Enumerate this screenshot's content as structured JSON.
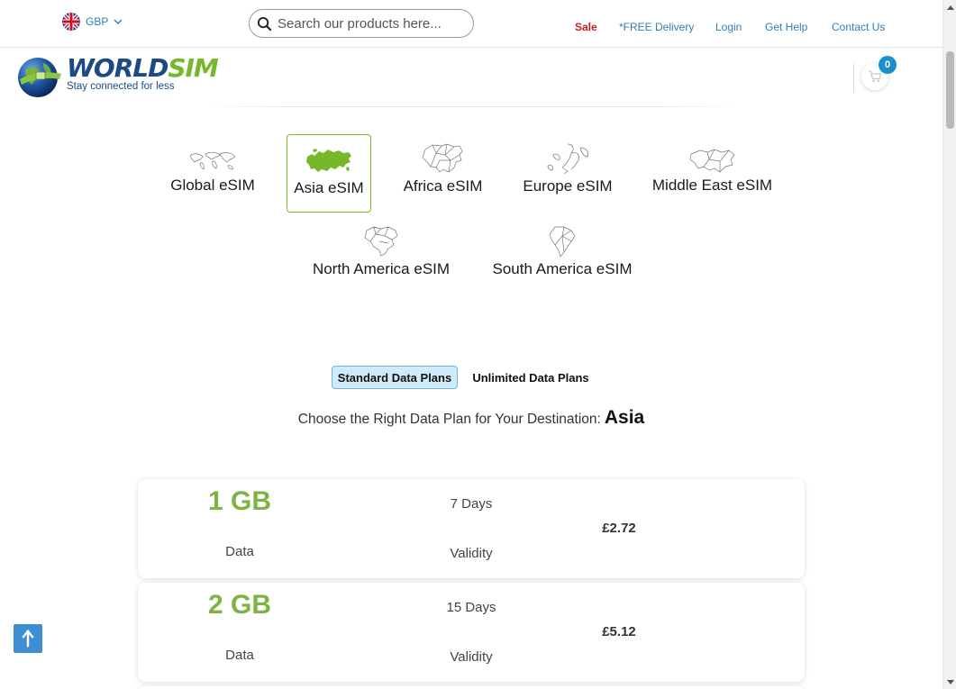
{
  "topbar": {
    "currency": "GBP",
    "search_placeholder": "Search our products here...",
    "links": [
      {
        "label": "Sale",
        "name": "sale-link"
      },
      {
        "label": "*FREE Delivery",
        "name": "free-delivery-link"
      },
      {
        "label": "Login",
        "name": "login-link"
      },
      {
        "label": "Get Help",
        "name": "get-help-link"
      },
      {
        "label": "Contact Us",
        "name": "contact-us-link"
      }
    ]
  },
  "header": {
    "logo_part1": "WORLD",
    "logo_part2": "SIM",
    "tagline": "Stay connected for less",
    "cart_count": "0"
  },
  "regions": [
    {
      "label": "Global eSIM",
      "active": false
    },
    {
      "label": "Asia eSIM",
      "active": true
    },
    {
      "label": "Africa eSIM",
      "active": false
    },
    {
      "label": "Europe eSIM",
      "active": false
    },
    {
      "label": "Middle East eSIM",
      "active": false
    },
    {
      "label": "North America eSIM",
      "active": false
    },
    {
      "label": "South America eSIM",
      "active": false
    }
  ],
  "plan_tabs": [
    {
      "label": "Standard Data Plans",
      "active": true
    },
    {
      "label": "Unlimited Data Plans",
      "active": false
    }
  ],
  "choose": {
    "text": "Choose the Right Data Plan for Your Destination:",
    "destination": "Asia"
  },
  "plans": [
    {
      "amount": "1 GB",
      "amount_label": "Data",
      "days": "7 Days",
      "validity_label": "Validity",
      "price": "£2.72"
    },
    {
      "amount": "2 GB",
      "amount_label": "Data",
      "days": "15 Days",
      "validity_label": "Validity",
      "price": "£5.12"
    }
  ],
  "colors": {
    "brand_blue": "#1b4a86",
    "brand_green": "#76b82a",
    "link_blue": "#2f7fb7",
    "sale_red": "#cc1b1b",
    "tab_active_bg": "#cfeaf8"
  },
  "icons": {
    "currency": "uk-flag-icon",
    "search": "search-icon",
    "cart": "cart-icon",
    "to_top": "arrow-up-icon"
  }
}
